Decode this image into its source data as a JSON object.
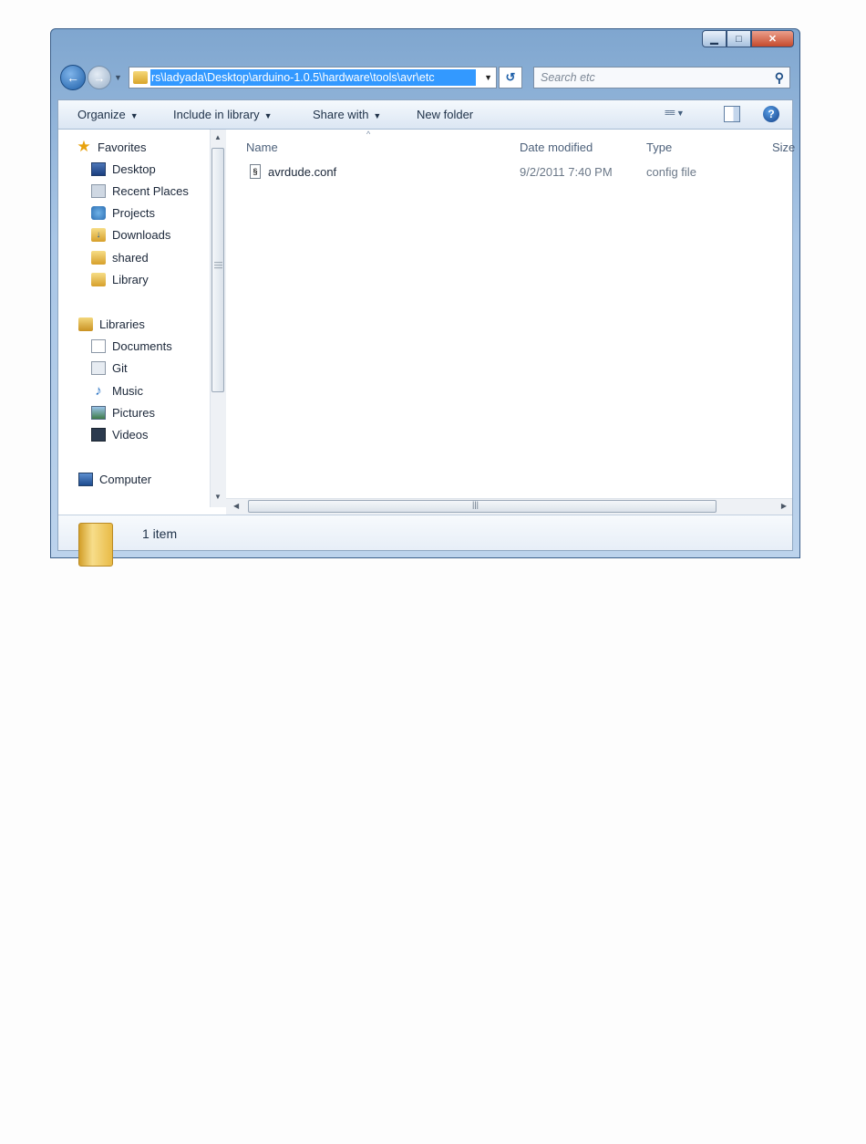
{
  "window": {
    "caption_buttons": {
      "minimize": "▁",
      "maximize": "□",
      "close": "✕"
    }
  },
  "nav": {
    "back_icon": "back-arrow-icon",
    "forward_icon": "forward-arrow-icon",
    "address_path": "rs\\ladyada\\Desktop\\arduino-1.0.5\\hardware\\tools\\avr\\etc",
    "search_placeholder": "Search etc"
  },
  "toolbar": {
    "organize": "Organize",
    "include_in_library": "Include in library",
    "share_with": "Share with",
    "new_folder": "New folder"
  },
  "sidebar": {
    "favorites_label": "Favorites",
    "favorites": [
      {
        "label": "Desktop",
        "icon": "desktop-icon"
      },
      {
        "label": "Recent Places",
        "icon": "recent-places-icon"
      },
      {
        "label": "Projects",
        "icon": "projects-icon"
      },
      {
        "label": "Downloads",
        "icon": "downloads-icon"
      },
      {
        "label": "shared",
        "icon": "folder-icon"
      },
      {
        "label": "Library",
        "icon": "folder-icon"
      }
    ],
    "libraries_label": "Libraries",
    "libraries": [
      {
        "label": "Documents",
        "icon": "documents-icon"
      },
      {
        "label": "Git",
        "icon": "git-icon"
      },
      {
        "label": "Music",
        "icon": "music-icon"
      },
      {
        "label": "Pictures",
        "icon": "pictures-icon"
      },
      {
        "label": "Videos",
        "icon": "videos-icon"
      }
    ],
    "computer_label": "Computer"
  },
  "columns": {
    "name": "Name",
    "date_modified": "Date modified",
    "type": "Type",
    "size": "Size"
  },
  "files": [
    {
      "name": "avrdude.conf",
      "date_modified": "9/2/2011 7:40 PM",
      "type": "config file"
    }
  ],
  "status": {
    "item_count": "1 item"
  }
}
